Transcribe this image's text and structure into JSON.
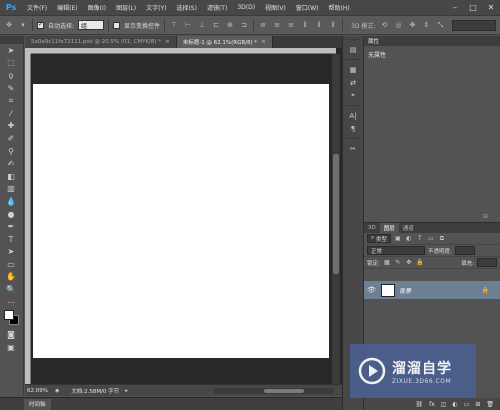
{
  "app": {
    "logo": "Ps"
  },
  "menu": [
    "文件(F)",
    "编辑(E)",
    "图像(I)",
    "图层(L)",
    "文字(Y)",
    "选择(S)",
    "滤镜(T)",
    "3D(D)",
    "视图(V)",
    "窗口(W)",
    "帮助(H)"
  ],
  "window_controls": [
    "–",
    "□",
    "✕"
  ],
  "options": {
    "auto_select_label": "自动选择:",
    "auto_select_value": "组",
    "show_transform_label": "显示变换控件",
    "mode_3d_label": "3D 模式:"
  },
  "tabs": [
    {
      "label": "5a0a9c11fe72111.psd @ 20.5% (01, CMYK/8) *",
      "active": false
    },
    {
      "label": "未标题-1 @ 62.1%(RGB/8) *",
      "active": true
    }
  ],
  "status": {
    "zoom": "62.09%",
    "doc_info": "文档:2.58M/0 字节"
  },
  "timeline": {
    "label": "时间轴"
  },
  "properties": {
    "title": "属性",
    "empty_text": "无属性"
  },
  "layers": {
    "tabs": [
      "3D",
      "图层",
      "通道"
    ],
    "filter_label": "类型",
    "blend_mode": "正常",
    "opacity_label": "不透明度:",
    "lock_label": "锁定:",
    "fill_label": "填充:",
    "items": [
      {
        "name": "背景"
      }
    ]
  },
  "watermark": {
    "name_cn": "溜溜自学",
    "url": "ZIXUE.3D66.COM"
  },
  "colors": {
    "foreground": "#ffffff",
    "background": "#000000",
    "accent": "#30a8ff"
  }
}
